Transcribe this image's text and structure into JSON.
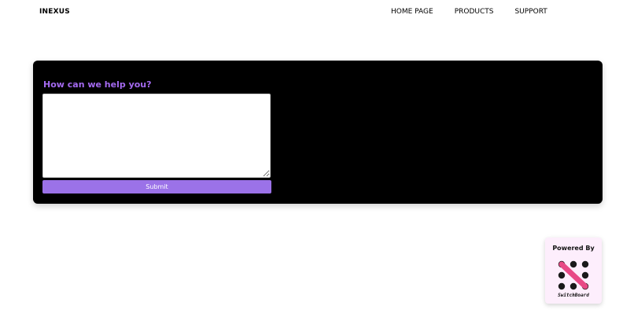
{
  "header": {
    "brand": "INEXUS",
    "nav": [
      {
        "label": "HOME PAGE"
      },
      {
        "label": "PRODUCTS"
      },
      {
        "label": "SUPPORT"
      }
    ]
  },
  "help_form": {
    "title": "How can we help you?",
    "textarea_value": "",
    "submit_label": "Submit"
  },
  "powered_by": {
    "label": "Powered By",
    "logo_text": "SwitchBoard",
    "icon": "switchboard-logo-icon"
  },
  "colors": {
    "panel_background": "#000000",
    "title_purple": "#a46af0",
    "button_purple": "#9b72e8",
    "badge_background": "#fdeefc",
    "logo_pink": "#e84a86",
    "logo_dots": "#1a1a1a"
  }
}
